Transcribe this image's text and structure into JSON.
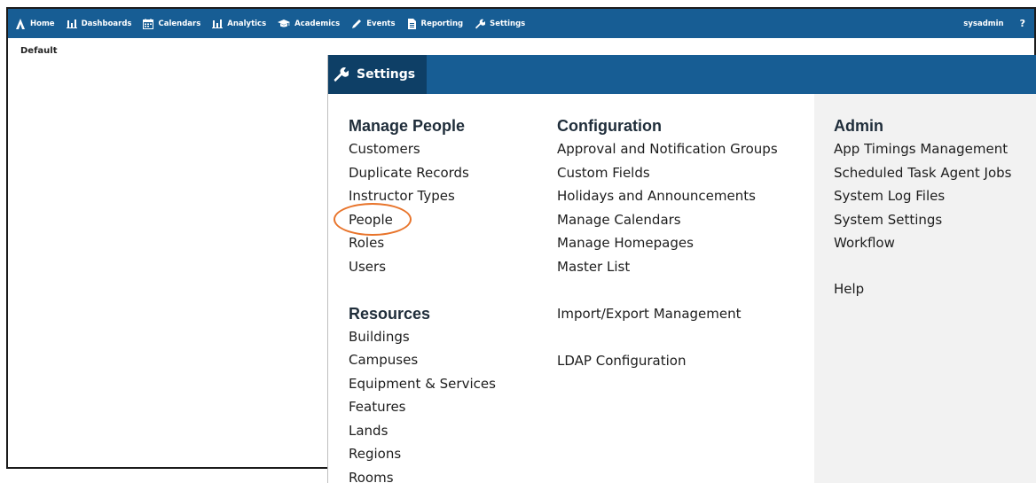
{
  "topnav": {
    "items": [
      {
        "label": "Home",
        "icon": "logo-icon"
      },
      {
        "label": "Dashboards",
        "icon": "bar-chart-icon"
      },
      {
        "label": "Calendars",
        "icon": "calendar-icon"
      },
      {
        "label": "Analytics",
        "icon": "bar-chart-icon"
      },
      {
        "label": "Academics",
        "icon": "graduation-cap-icon"
      },
      {
        "label": "Events",
        "icon": "pen-icon"
      },
      {
        "label": "Reporting",
        "icon": "document-icon"
      },
      {
        "label": "Settings",
        "icon": "wrench-icon"
      }
    ],
    "user": "sysadmin",
    "help": "?"
  },
  "page": {
    "label": "Default"
  },
  "settings": {
    "title": "Settings",
    "manage_people": {
      "heading": "Manage People",
      "items": [
        "Customers",
        "Duplicate Records",
        "Instructor Types",
        "People",
        "Roles",
        "Users"
      ]
    },
    "resources": {
      "heading": "Resources",
      "items": [
        "Buildings",
        "Campuses",
        "Equipment & Services",
        "Features",
        "Lands",
        "Regions",
        "Rooms"
      ]
    },
    "configuration": {
      "heading": "Configuration",
      "items": [
        "Approval and Notification Groups",
        "Custom Fields",
        "Holidays and Announcements",
        "Manage Calendars",
        "Manage Homepages",
        "Master List"
      ],
      "import_export": "Import/Export Management",
      "ldap": "LDAP Configuration"
    },
    "admin": {
      "heading": "Admin",
      "items": [
        "App Timings Management",
        "Scheduled Task Agent Jobs",
        "System Log Files",
        "System Settings",
        "Workflow"
      ],
      "help": "Help"
    }
  },
  "colors": {
    "nav_bg": "#175d94",
    "tab_bg": "#0e3f66",
    "highlight": "#e8742b",
    "admin_bg": "#f2f2f2"
  }
}
